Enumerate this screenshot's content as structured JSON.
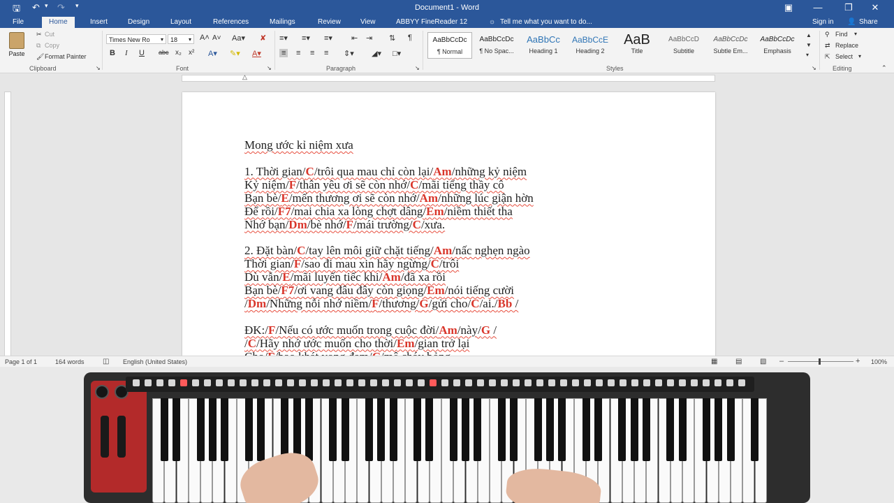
{
  "window": {
    "title": "Document1 - Word",
    "sign_in": "Sign in",
    "share": "Share"
  },
  "tabs": [
    "File",
    "Home",
    "Insert",
    "Design",
    "Layout",
    "References",
    "Mailings",
    "Review",
    "View",
    "ABBYY FineReader 12"
  ],
  "tell_me": "Tell me what you want to do...",
  "clipboard": {
    "paste": "Paste",
    "cut": "Cut",
    "copy": "Copy",
    "format_painter": "Format Painter",
    "label": "Clipboard"
  },
  "font": {
    "name": "Times New Ro",
    "size": "18",
    "label": "Font"
  },
  "paragraph_label": "Paragraph",
  "styles": {
    "label": "Styles",
    "items": [
      {
        "preview": "AaBbCcDc",
        "name": "¶ Normal"
      },
      {
        "preview": "AaBbCcDc",
        "name": "¶ No Spac..."
      },
      {
        "preview": "AaBbCc",
        "name": "Heading 1"
      },
      {
        "preview": "AaBbCcE",
        "name": "Heading 2"
      },
      {
        "preview": "AaB",
        "name": "Title"
      },
      {
        "preview": "AaBbCcD",
        "name": "Subtitle"
      },
      {
        "preview": "AaBbCcDc",
        "name": "Subtle Em..."
      },
      {
        "preview": "AaBbCcDc",
        "name": "Emphasis"
      }
    ]
  },
  "editing": {
    "find": "Find",
    "replace": "Replace",
    "select": "Select",
    "label": "Editing"
  },
  "status": {
    "page": "Page 1 of 1",
    "words": "164 words",
    "language": "English (United States)",
    "zoom": "100%"
  },
  "document": {
    "lines": [
      [
        {
          "t": "Mong ước kỉ niệm xưa"
        }
      ],
      [],
      [
        {
          "t": "1. Thời gian/"
        },
        {
          "t": "C",
          "c": 1
        },
        {
          "t": "/trôi qua mau chỉ còn lại/"
        },
        {
          "t": "Am",
          "c": 1
        },
        {
          "t": "/những kỷ niệm"
        }
      ],
      [
        {
          "t": "Kỷ niệm/"
        },
        {
          "t": "F",
          "c": 1
        },
        {
          "t": "/thân yêu ơi sẽ còn nhớ/"
        },
        {
          "t": "C",
          "c": 1
        },
        {
          "t": "/mãi tiếng thầy cô"
        }
      ],
      [
        {
          "t": "Bạn bè/"
        },
        {
          "t": "E",
          "c": 1
        },
        {
          "t": "/mến thương ơi sẽ còn nhớ/"
        },
        {
          "t": "Am",
          "c": 1
        },
        {
          "t": "/những lúc giận hờn"
        }
      ],
      [
        {
          "t": "Để rồi/"
        },
        {
          "t": "F7",
          "c": 1
        },
        {
          "t": "/mai chia xa lòng chợt dâng/"
        },
        {
          "t": "Em",
          "c": 1
        },
        {
          "t": "/niềm thiết tha"
        }
      ],
      [
        {
          "t": "Nhớ bạn/"
        },
        {
          "t": "Dm",
          "c": 1
        },
        {
          "t": "/bè nhớ/"
        },
        {
          "t": "F",
          "c": 1
        },
        {
          "t": "/mái trường/"
        },
        {
          "t": "C",
          "c": 1
        },
        {
          "t": "/xưa."
        }
      ],
      [],
      [
        {
          "t": "2. Đặt bàn/"
        },
        {
          "t": "C",
          "c": 1
        },
        {
          "t": "/tay lên môi giữ chặt tiếng/"
        },
        {
          "t": "Am",
          "c": 1
        },
        {
          "t": "/nấc nghẹn ngào"
        }
      ],
      [
        {
          "t": "Thời gian/"
        },
        {
          "t": "F",
          "c": 1
        },
        {
          "t": "/sao đi mau xin hãy ngừng/"
        },
        {
          "t": "C",
          "c": 1
        },
        {
          "t": "/trôi"
        }
      ],
      [
        {
          "t": "Dù vẫn/"
        },
        {
          "t": "E",
          "c": 1
        },
        {
          "t": "/mãi luyến tiếc khi/"
        },
        {
          "t": "Am",
          "c": 1
        },
        {
          "t": "/đã xa rồi"
        }
      ],
      [
        {
          "t": "Bạn bè/"
        },
        {
          "t": "F7",
          "c": 1
        },
        {
          "t": "/ơi vang đâu đây còn giọng/"
        },
        {
          "t": "Em",
          "c": 1
        },
        {
          "t": "/nói tiếng cười"
        }
      ],
      [
        {
          "t": "/"
        },
        {
          "t": "Dm",
          "c": 1
        },
        {
          "t": "/Những nỗi nhớ niềm/"
        },
        {
          "t": "F",
          "c": 1
        },
        {
          "t": "/thương/"
        },
        {
          "t": "G",
          "c": 1
        },
        {
          "t": "/gửi cho/"
        },
        {
          "t": "C",
          "c": 1
        },
        {
          "t": "/ai./"
        },
        {
          "t": "Bb",
          "c": 1
        },
        {
          "t": " /"
        }
      ],
      [],
      [
        {
          "t": "ĐK:/"
        },
        {
          "t": "F",
          "c": 1
        },
        {
          "t": "/Nếu có ước muốn trong cuộc đời/"
        },
        {
          "t": "Am",
          "c": 1
        },
        {
          "t": "/này/"
        },
        {
          "t": "G",
          "c": 1
        },
        {
          "t": " /"
        }
      ],
      [
        {
          "t": "/"
        },
        {
          "t": "C",
          "c": 1
        },
        {
          "t": "/Hãy nhớ ước muốn cho thời/"
        },
        {
          "t": "Em",
          "c": 1
        },
        {
          "t": "/gian trở lại"
        }
      ],
      [
        {
          "t": "Cho/"
        },
        {
          "t": "F",
          "c": 1
        },
        {
          "t": "/bao khát vọng đam/"
        },
        {
          "t": "C",
          "c": 1
        },
        {
          "t": "/mê cháy bỏng"
        }
      ]
    ]
  }
}
